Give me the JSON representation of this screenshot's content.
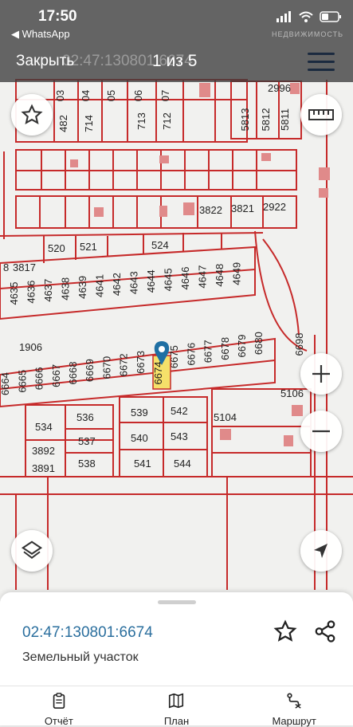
{
  "status_bar": {
    "time": "17:50",
    "back_app": "◀ WhatsApp"
  },
  "header": {
    "close_label": "Закрыть",
    "title": "02:47:130801:6674",
    "counter": "1 из 5",
    "watermark": "НЕДВИЖИМОСТЬ"
  },
  "map": {
    "plots_top": [
      "03",
      "04",
      "05",
      "06",
      "07",
      "482",
      "714",
      "713",
      "712",
      "5813",
      "5812",
      "5811",
      "2996"
    ],
    "plots_row2": [
      "3822",
      "3821",
      "2922"
    ],
    "plots_row3": [
      "8",
      "3817",
      "520",
      "521",
      "524"
    ],
    "plots_row4": [
      "4635",
      "4636",
      "4637",
      "4638",
      "4639",
      "4641",
      "4642",
      "4643",
      "4644",
      "4645",
      "4646",
      "4647",
      "4648",
      "4649"
    ],
    "plots_row5": [
      "1906",
      "6664",
      "6665",
      "6666",
      "6667",
      "6668",
      "6669",
      "6670",
      "6672",
      "6673",
      "6674",
      "6675",
      "6676",
      "6677",
      "6678",
      "6679",
      "6680",
      "6698",
      "5106"
    ],
    "plots_row6": [
      "534",
      "536",
      "537",
      "3892",
      "3891",
      "538",
      "539",
      "542",
      "540",
      "543",
      "541",
      "544",
      "5104"
    ],
    "selected": "6674"
  },
  "sheet": {
    "cadastral_number": "02:47:130801:6674",
    "parcel_type": "Земельный участок"
  },
  "tabs": [
    {
      "label": "Отчёт",
      "icon": "clipboard-icon"
    },
    {
      "label": "План",
      "icon": "map-icon"
    },
    {
      "label": "Маршрут",
      "icon": "route-icon"
    }
  ]
}
